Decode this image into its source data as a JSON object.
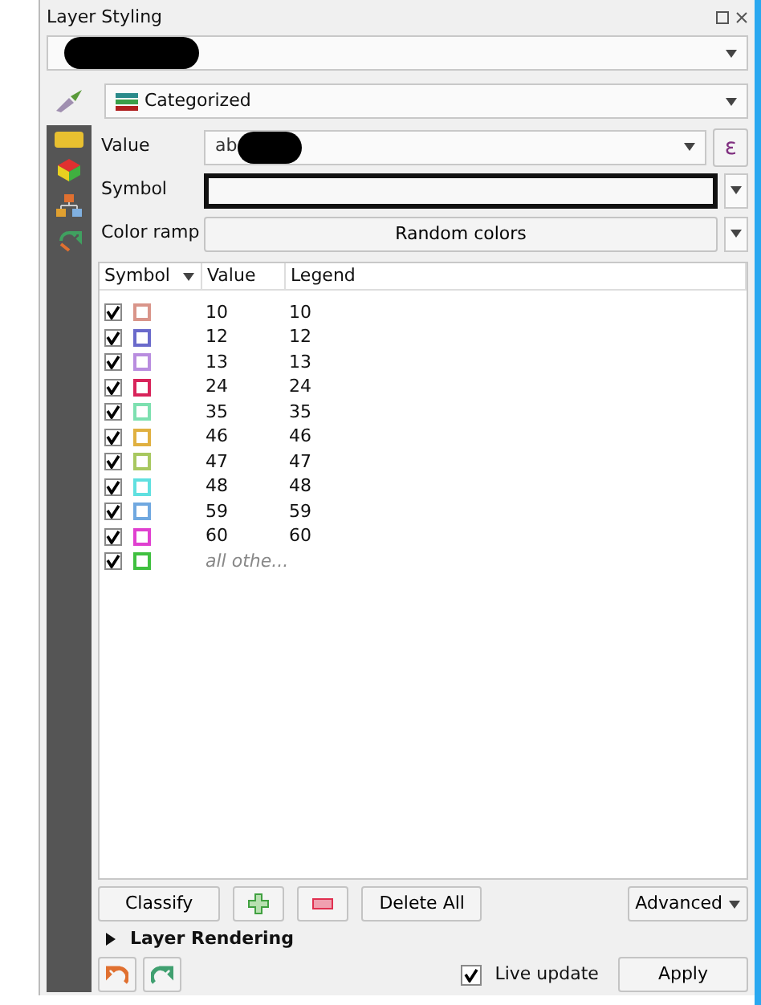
{
  "panel": {
    "title": "Layer Styling",
    "renderer": "Categorized"
  },
  "fields": [
    {
      "kind": "combo",
      "label": "Value",
      "value": "ab",
      "button": "ε"
    },
    {
      "kind": "symbol",
      "label": "Symbol"
    },
    {
      "kind": "ramp",
      "label": "Color ramp",
      "value": "Random colors"
    }
  ],
  "table": {
    "columns": [
      "Symbol",
      "Value",
      "Legend"
    ],
    "rows": [
      {
        "checked": true,
        "color": "#d9958a",
        "value": "10",
        "legend": "10"
      },
      {
        "checked": true,
        "color": "#6a6acb",
        "value": "12",
        "legend": "12"
      },
      {
        "checked": true,
        "color": "#b98ddf",
        "value": "13",
        "legend": "13"
      },
      {
        "checked": true,
        "color": "#d8245a",
        "value": "24",
        "legend": "24"
      },
      {
        "checked": true,
        "color": "#7de0b0",
        "value": "35",
        "legend": "35"
      },
      {
        "checked": true,
        "color": "#e0b040",
        "value": "46",
        "legend": "46"
      },
      {
        "checked": true,
        "color": "#a8c860",
        "value": "47",
        "legend": "47"
      },
      {
        "checked": true,
        "color": "#60e0e0",
        "value": "48",
        "legend": "48"
      },
      {
        "checked": true,
        "color": "#70a8e0",
        "value": "59",
        "legend": "59"
      },
      {
        "checked": true,
        "color": "#e040d0",
        "value": "60",
        "legend": "60"
      },
      {
        "checked": true,
        "color": "#40c040",
        "value": "all othe...",
        "legend": "",
        "other": true
      }
    ]
  },
  "buttons": {
    "classify": "Classify",
    "delete_all": "Delete All",
    "advanced": "Advanced"
  },
  "section": {
    "label": "Layer Rendering",
    "expanded": false
  },
  "live_update": {
    "label": "Live update",
    "checked": true
  },
  "apply": "Apply"
}
